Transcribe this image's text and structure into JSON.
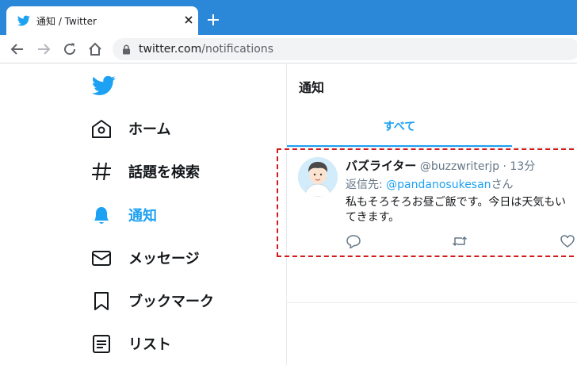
{
  "browser": {
    "tab_title": "通知 / Twitter",
    "url_host": "twitter.com",
    "url_path": "/notifications",
    "accent": "#2b88d9"
  },
  "sidebar": {
    "items": [
      {
        "label": "ホーム",
        "icon": "home-icon"
      },
      {
        "label": "話題を検索",
        "icon": "hashtag-icon"
      },
      {
        "label": "通知",
        "icon": "bell-icon",
        "active": true
      },
      {
        "label": "メッセージ",
        "icon": "mail-icon"
      },
      {
        "label": "ブックマーク",
        "icon": "bookmark-icon"
      },
      {
        "label": "リスト",
        "icon": "list-icon"
      }
    ],
    "active_color": "#1da1f2"
  },
  "main": {
    "title": "通知",
    "tab_all": "すべて"
  },
  "tweet": {
    "author": "バズライター",
    "handle": "@buzzwriterjp",
    "separator": "·",
    "time": "13分",
    "reply_prefix": "返信先: ",
    "reply_mention": "@pandanosukesan",
    "reply_suffix": "さん",
    "text_line1": "私もそろそろお昼ご飯です。今日は天気もい",
    "text_line2": "てきます。"
  }
}
